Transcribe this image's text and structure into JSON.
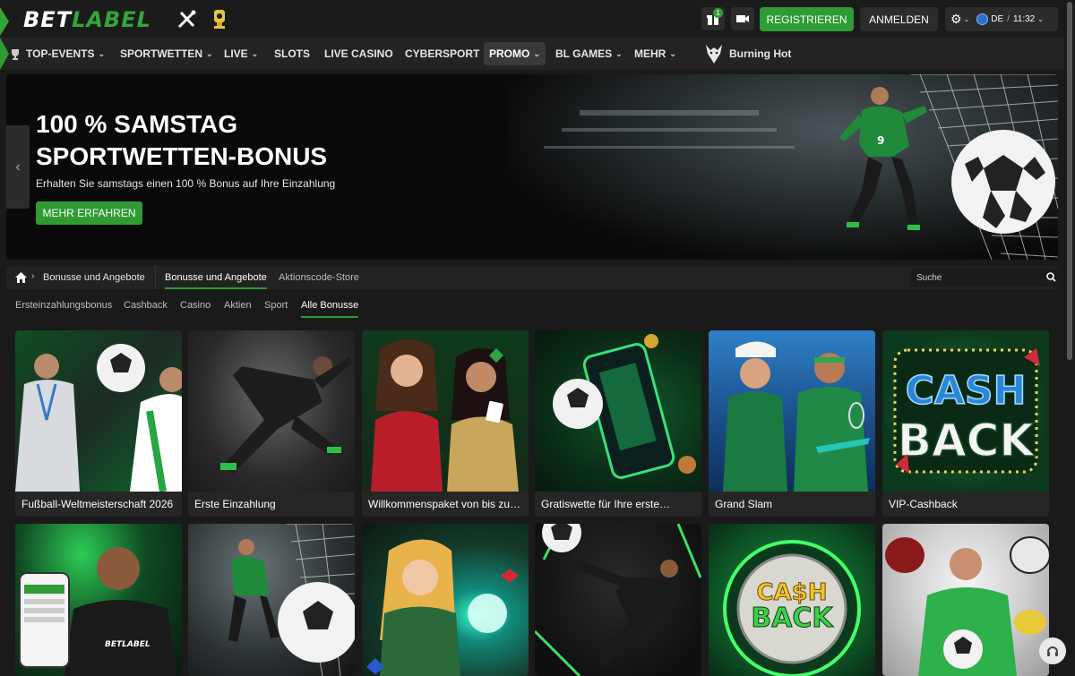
{
  "header": {
    "logo_main": "BET",
    "logo_accent": "LABEL",
    "gift_badge": "1",
    "register_label": "REGISTRIEREN",
    "login_label": "ANMELDEN",
    "language": "DE",
    "clock": "11:32",
    "lang_separator": "/"
  },
  "nav": {
    "items": [
      {
        "label": "TOP-EVENTS",
        "icon": "trophy-icon",
        "dropdown": true
      },
      {
        "label": "SPORTWETTEN",
        "dropdown": true
      },
      {
        "label": "LIVE",
        "dropdown": true
      },
      {
        "label": "SLOTS",
        "dropdown": false
      },
      {
        "label": "LIVE CASINO",
        "dropdown": false
      },
      {
        "label": "CYBERSPORT",
        "dropdown": false
      },
      {
        "label": "PROMO",
        "dropdown": true,
        "active": true
      },
      {
        "label": "BL GAMES",
        "dropdown": true
      },
      {
        "label": "MEHR",
        "dropdown": true
      },
      {
        "label": "Burning Hot",
        "icon": "wolf-icon",
        "dropdown": false
      }
    ]
  },
  "banner": {
    "title_line1": "100 % SAMSTAG",
    "title_line2": "SPORTWETTEN-BONUS",
    "subtitle": "Erhalten Sie samstags einen 100 % Bonus auf Ihre Einzahlung",
    "cta": "MEHR ERFAHREN"
  },
  "breadcrumb": {
    "items": [
      "Bonusse und Angebote"
    ],
    "tabs": [
      {
        "label": "Bonusse und Angebote",
        "active": true
      },
      {
        "label": "Aktionscode-Store",
        "active": false
      }
    ],
    "search_placeholder": "Suche"
  },
  "filters": [
    {
      "label": "Ersteinzahlungsbonus",
      "active": false
    },
    {
      "label": "Cashback",
      "active": false
    },
    {
      "label": "Casino",
      "active": false
    },
    {
      "label": "Aktien",
      "active": false
    },
    {
      "label": "Sport",
      "active": false
    },
    {
      "label": "Alle Bonusse",
      "active": true
    }
  ],
  "cards_row1": [
    {
      "title": "Fußball-Weltmeisterschaft 2026",
      "theme": "football-players"
    },
    {
      "title": "Erste Einzahlung",
      "theme": "football-kick"
    },
    {
      "title": "Willkommenspaket von bis zu…",
      "theme": "casino-women"
    },
    {
      "title": "Gratiswette für Ihre erste…",
      "theme": "phone-football"
    },
    {
      "title": "Grand Slam",
      "theme": "tennis"
    },
    {
      "title": "VIP-Cashback",
      "theme": "cashback-sign"
    }
  ],
  "cards_row2": [
    {
      "theme": "app-promo",
      "brand": "BETLABEL"
    },
    {
      "theme": "goalkeeper-net"
    },
    {
      "theme": "fantasy-casino"
    },
    {
      "theme": "football-volley"
    },
    {
      "theme": "cashback-coin",
      "word1": "CA$H",
      "word2": "BACK"
    },
    {
      "theme": "multi-sport"
    }
  ],
  "cashback_card_text": {
    "line1": "CASH",
    "line2": "BACK"
  },
  "colors": {
    "accent": "#2e9c33",
    "background": "#1a1a1a",
    "panel": "#232323"
  }
}
